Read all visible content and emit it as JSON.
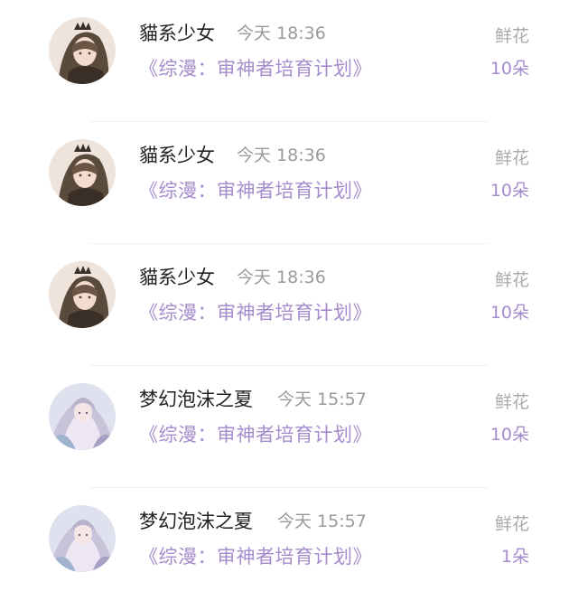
{
  "rows": [
    {
      "user": "貓系少女",
      "time": "今天 18:36",
      "book": "《综漫：审神者培育计划》",
      "gift": "鲜花",
      "count": "10朵",
      "avatar_icon": "girl-veil-avatar-icon"
    },
    {
      "user": "貓系少女",
      "time": "今天 18:36",
      "book": "《综漫：审神者培育计划》",
      "gift": "鲜花",
      "count": "10朵",
      "avatar_icon": "girl-veil-avatar-icon"
    },
    {
      "user": "貓系少女",
      "time": "今天 18:36",
      "book": "《综漫：审神者培育计划》",
      "gift": "鲜花",
      "count": "10朵",
      "avatar_icon": "girl-veil-avatar-icon"
    },
    {
      "user": "梦幻泡沫之夏",
      "time": "今天 15:57",
      "book": "《综漫：审神者培育计划》",
      "gift": "鲜花",
      "count": "10朵",
      "avatar_icon": "fantasy-girl-avatar-icon"
    },
    {
      "user": "梦幻泡沫之夏",
      "time": "今天 15:57",
      "book": "《综漫：审神者培育计划》",
      "gift": "鲜花",
      "count": "1朵",
      "avatar_icon": "fantasy-girl-avatar-icon"
    }
  ],
  "colors": {
    "accent": "#a58ccc",
    "name": "#222222",
    "muted": "#9a9a9a"
  }
}
